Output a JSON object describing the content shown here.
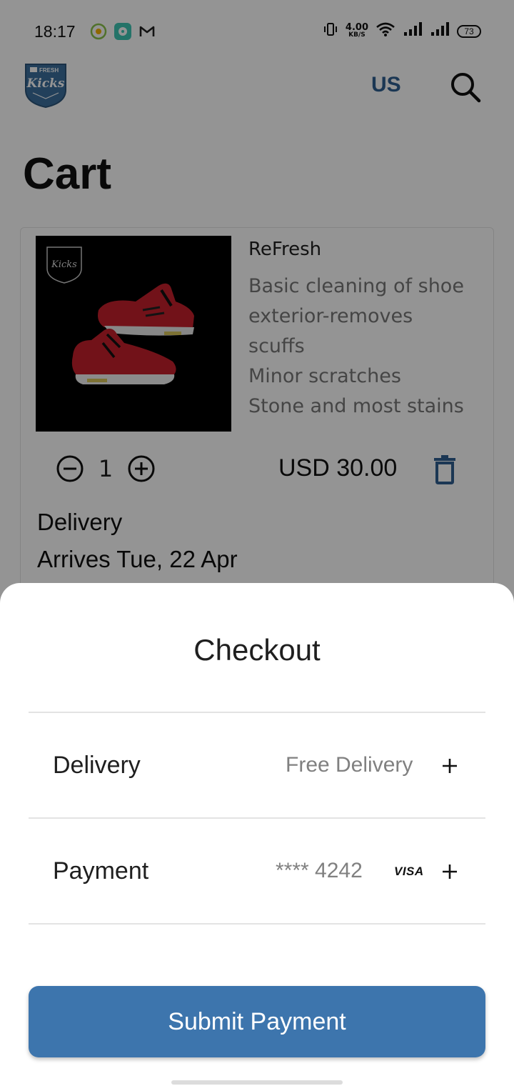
{
  "status_bar": {
    "time": "18:17",
    "app_icons": [
      "circle-target-icon",
      "chat-bubble-icon",
      "gmail-icon"
    ],
    "net_speed_value": "4.00",
    "net_speed_unit": "KB/S",
    "battery": "73"
  },
  "header": {
    "logo_text_top": "FRESH",
    "logo_text_main": "Kicks",
    "region": "US"
  },
  "page": {
    "title": "Cart"
  },
  "cart_item": {
    "name": "ReFresh",
    "description_lines": [
      "Basic cleaning of shoe",
      "exterior-removes",
      "scuffs",
      "Minor scratches",
      "Stone and most stains"
    ],
    "quantity": "1",
    "price": "USD 30.00",
    "delivery_label": "Delivery",
    "delivery_arrival": "Arrives Tue, 22 Apr"
  },
  "checkout": {
    "title": "Checkout",
    "delivery_label": "Delivery",
    "delivery_value": "Free Delivery",
    "payment_label": "Payment",
    "payment_value": "**** 4242",
    "card_brand": "VISA",
    "submit_label": "Submit Payment"
  },
  "colors": {
    "accent": "#3d75ad",
    "region_text": "#2f5f92",
    "overlay": "rgba(0,0,0,0.42)"
  }
}
